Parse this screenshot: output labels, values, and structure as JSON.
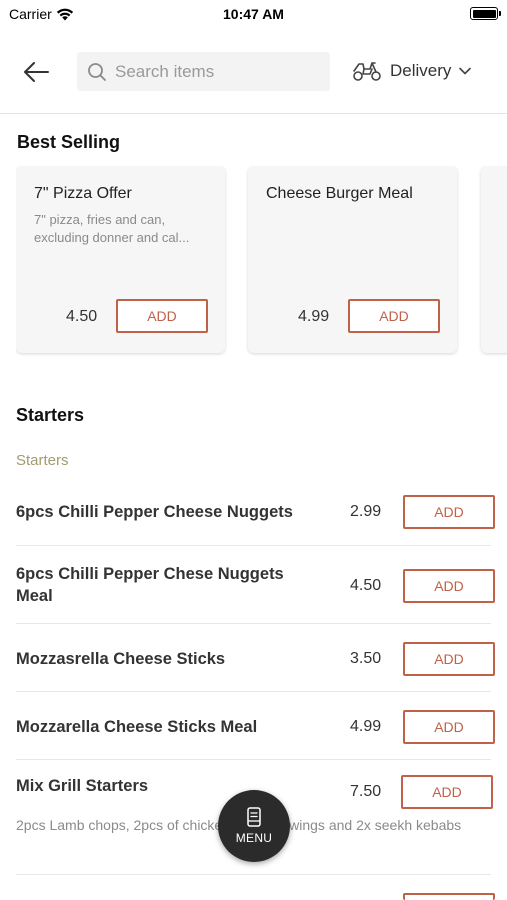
{
  "status_bar": {
    "carrier": "Carrier",
    "time": "10:47 AM"
  },
  "header": {
    "back_icon": "arrow-left-icon",
    "search_placeholder": "Search items",
    "delivery_label": "Delivery",
    "delivery_icon": "scooter-icon"
  },
  "best_selling": {
    "title": "Best Selling",
    "cards": [
      {
        "name": "7\" Pizza Offer",
        "description": "7\" pizza, fries and can, excluding donner and cal...",
        "price": "4.50",
        "add_label": "ADD"
      },
      {
        "name": "Cheese Burger Meal",
        "description": "",
        "price": "4.99",
        "add_label": "ADD"
      }
    ]
  },
  "starters": {
    "title": "Starters",
    "subtitle": "Starters",
    "items": [
      {
        "name": "6pcs Chilli Pepper Cheese Nuggets",
        "price": "2.99",
        "add_label": "ADD"
      },
      {
        "name": "6pcs Chilli Pepper Chese Nuggets Meal",
        "price": "4.50",
        "add_label": "ADD"
      },
      {
        "name": "Mozzasrella Cheese Sticks",
        "price": "3.50",
        "add_label": "ADD"
      },
      {
        "name": "Mozzarella Cheese Sticks Meal",
        "price": "4.99",
        "add_label": "ADD"
      },
      {
        "name": "Mix Grill Starters",
        "price": "7.50",
        "add_label": "ADD",
        "description": "2pcs Lamb chops, 2pcs of chicken tikka, 2x wings and 2x seekh kebabs"
      }
    ]
  },
  "menu_button": {
    "label": "MENU",
    "icon": "menu-book-icon"
  },
  "colors": {
    "accent": "#c0614a",
    "subtitle": "#a59a6e",
    "fab": "#2b2b2b"
  }
}
